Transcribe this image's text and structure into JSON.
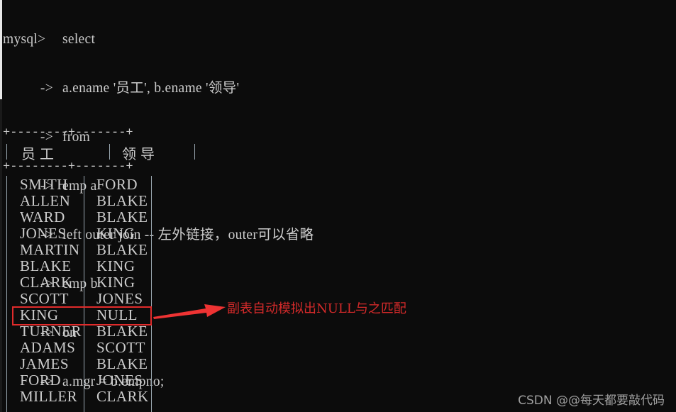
{
  "terminal": {
    "prompt": "mysql>",
    "continuation": "->",
    "first_line": "select",
    "lines": [
      "a.ename '员工', b.ename '领导'",
      "from",
      "emp a",
      "left outer join -- 左外链接，outer可以省略",
      "emp b",
      "on",
      "a.mgr = b.empno;"
    ]
  },
  "table": {
    "border": "+--------+-------+",
    "columns": [
      "员工",
      "领导"
    ],
    "rows": [
      [
        "SMITH",
        "FORD"
      ],
      [
        "ALLEN",
        "BLAKE"
      ],
      [
        "WARD",
        "BLAKE"
      ],
      [
        "JONES",
        "KING"
      ],
      [
        "MARTIN",
        "BLAKE"
      ],
      [
        "BLAKE",
        "KING"
      ],
      [
        "CLARK",
        "KING"
      ],
      [
        "SCOTT",
        "JONES"
      ],
      [
        "KING",
        "NULL"
      ],
      [
        "TURNER",
        "BLAKE"
      ],
      [
        "ADAMS",
        "SCOTT"
      ],
      [
        "JAMES",
        "BLAKE"
      ],
      [
        "FORD",
        "JONES"
      ],
      [
        "MILLER",
        "CLARK"
      ]
    ],
    "highlighted_row_index": 8
  },
  "annotation": {
    "text": "副表自动模拟出NULL与之匹配",
    "color": "#d42a2a"
  },
  "watermark": "CSDN @@每天都要敲代码"
}
